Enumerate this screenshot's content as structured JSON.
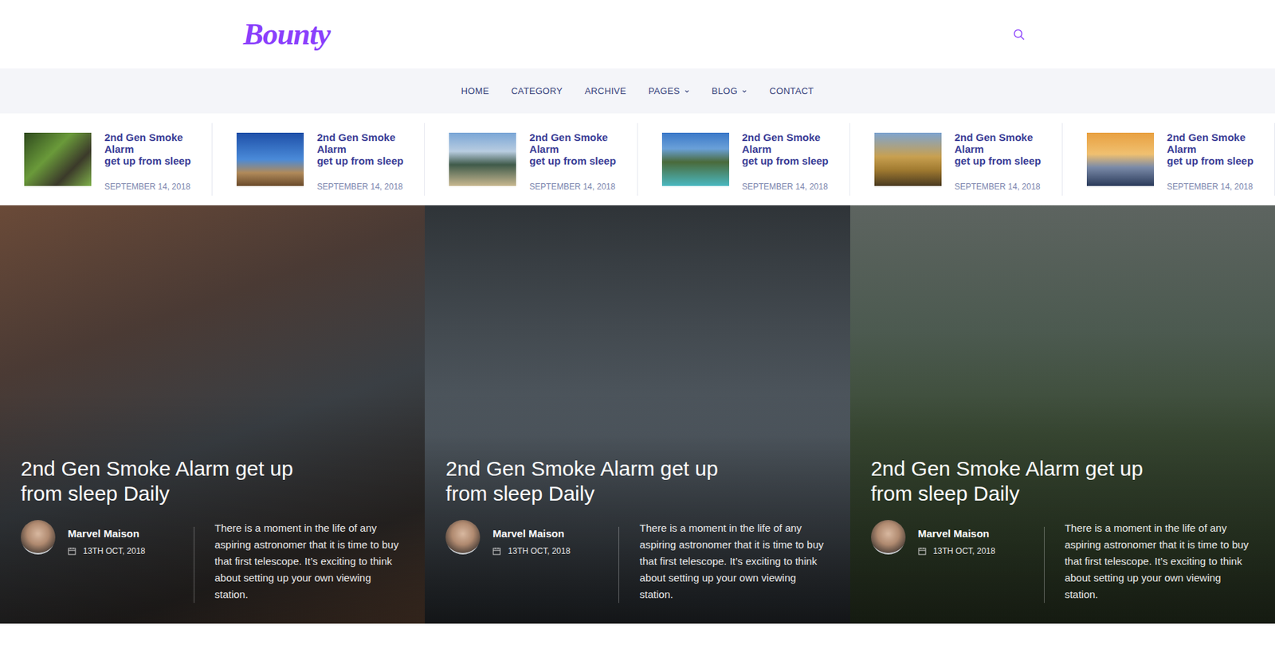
{
  "logo": "Bounty",
  "nav": [
    {
      "label": "HOME",
      "dropdown": false
    },
    {
      "label": "CATEGORY",
      "dropdown": false
    },
    {
      "label": "ARCHIVE",
      "dropdown": false
    },
    {
      "label": "PAGES",
      "dropdown": true
    },
    {
      "label": "BLOG",
      "dropdown": true
    },
    {
      "label": "CONTACT",
      "dropdown": false
    }
  ],
  "ticker": [
    {
      "title": "2nd Gen Smoke Alarm",
      "subtitle": "get up from sleep",
      "date": "SEPTEMBER 14, 2018"
    },
    {
      "title": "2nd Gen Smoke Alarm",
      "subtitle": "get up from sleep",
      "date": "SEPTEMBER 14, 2018"
    },
    {
      "title": "2nd Gen Smoke Alarm",
      "subtitle": "get up from sleep",
      "date": "SEPTEMBER 14, 2018"
    },
    {
      "title": "2nd Gen Smoke Alarm",
      "subtitle": "get up from sleep",
      "date": "SEPTEMBER 14, 2018"
    },
    {
      "title": "2nd Gen Smoke Alarm",
      "subtitle": "get up from sleep",
      "date": "SEPTEMBER 14, 2018"
    },
    {
      "title": "2nd Gen Smoke Alarm",
      "subtitle": "get up from sleep",
      "date": "SEPTEMBER 14, 2018"
    }
  ],
  "posts": [
    {
      "title": "2nd Gen Smoke Alarm get up from sleep Daily",
      "author": "Marvel Maison",
      "date": "13TH OCT, 2018",
      "excerpt": "There is a moment in the life of any aspiring astronomer that it is time to buy that first telescope. It’s exciting to think about setting up your own viewing station."
    },
    {
      "title": "2nd Gen Smoke Alarm get up from sleep Daily",
      "author": "Marvel Maison",
      "date": "13TH OCT, 2018",
      "excerpt": "There is a moment in the life of any aspiring astronomer that it is time to buy that first telescope. It’s exciting to think about setting up your own viewing station."
    },
    {
      "title": "2nd Gen Smoke Alarm get up from sleep Daily",
      "author": "Marvel Maison",
      "date": "13TH OCT, 2018",
      "excerpt": "There is a moment in the life of any aspiring astronomer that it is time to buy that first telescope. It’s exciting to think about setting up your own viewing station."
    }
  ]
}
